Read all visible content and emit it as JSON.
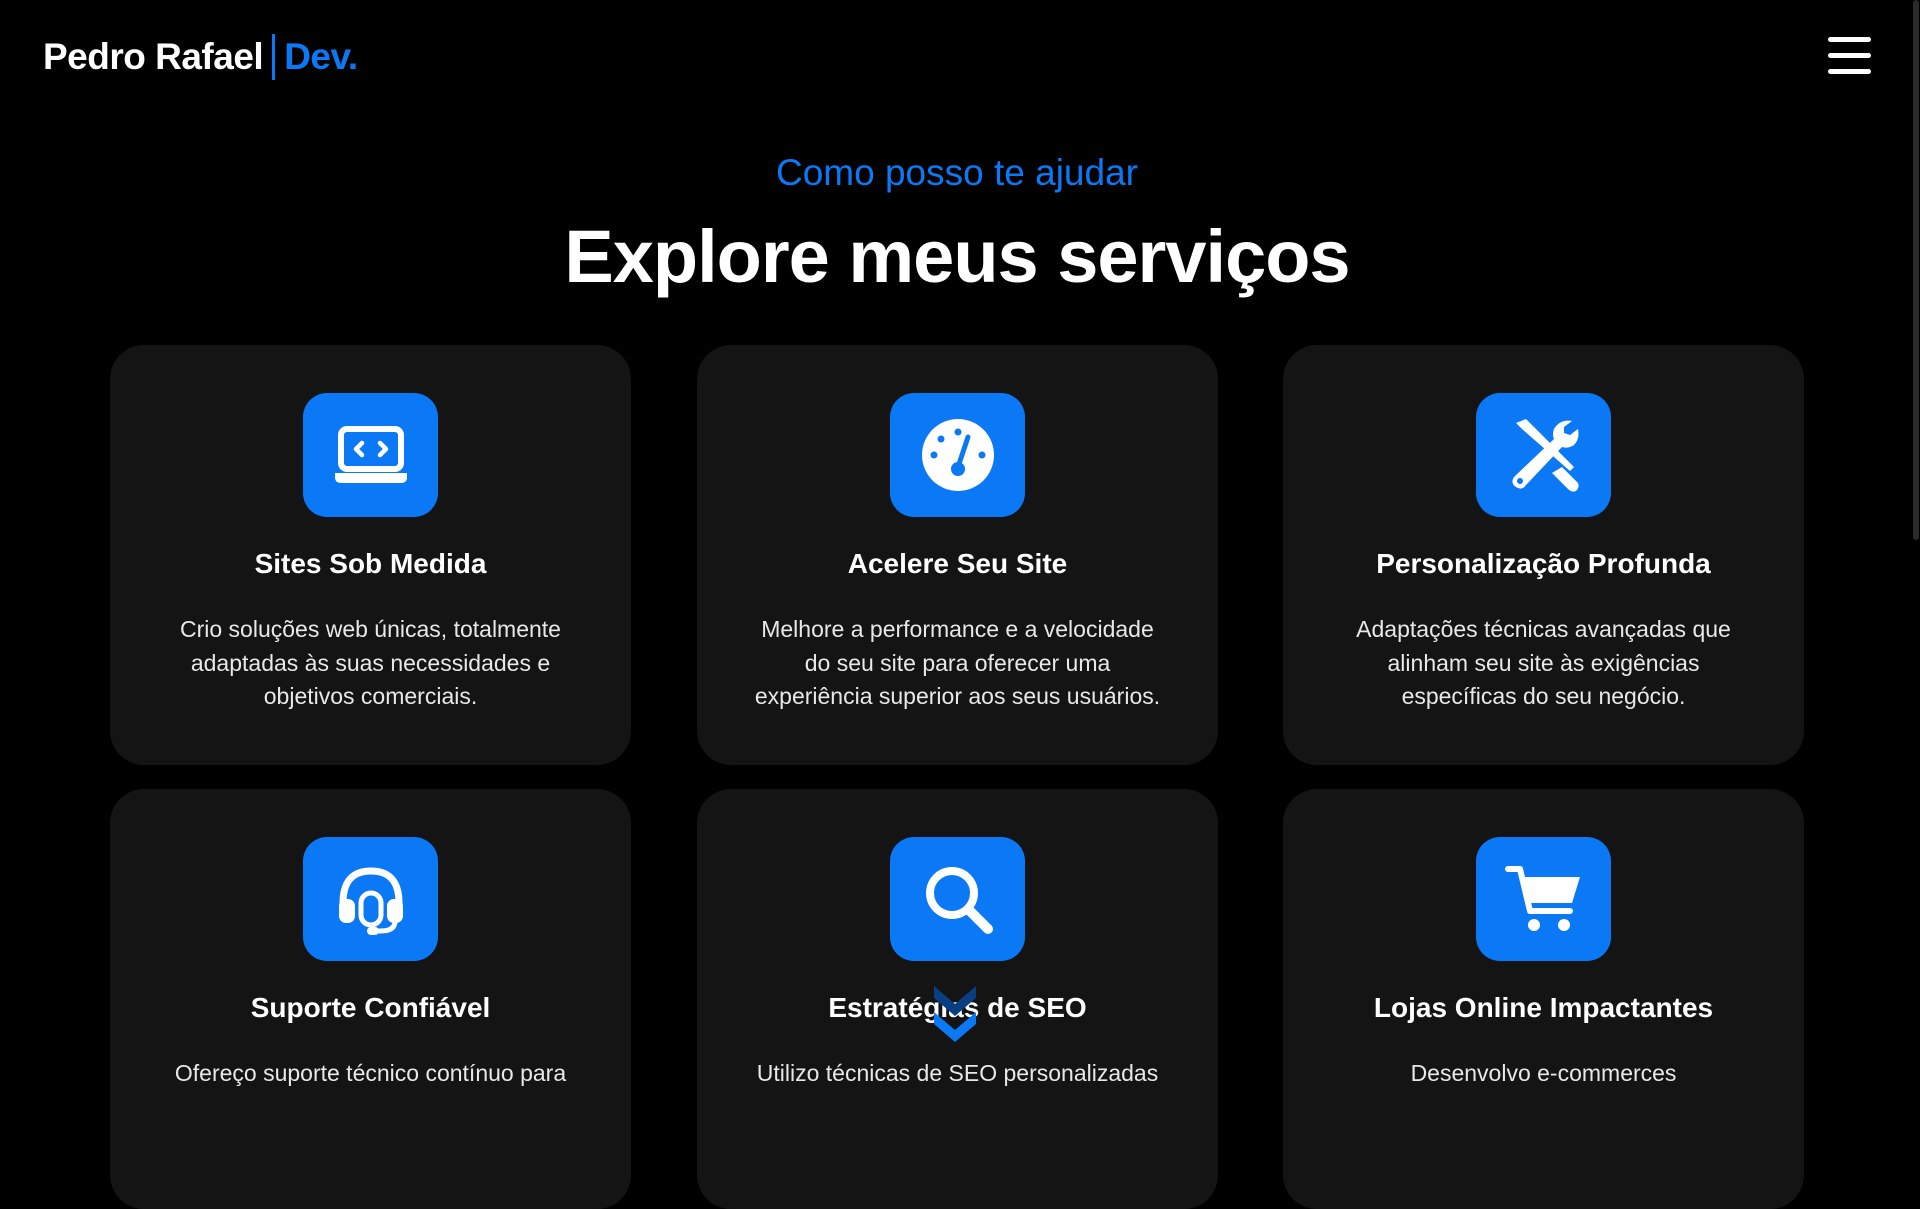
{
  "header": {
    "logo_name": "Pedro Rafael",
    "logo_accent": "Dev.",
    "menu_icon": "hamburger-menu-icon"
  },
  "section": {
    "eyebrow": "Como posso te ajudar",
    "title": "Explore meus serviços"
  },
  "services": [
    {
      "icon": "laptop-code-icon",
      "title": "Sites Sob Medida",
      "description": "Crio soluções web únicas, totalmente adaptadas às suas necessidades e objetivos comerciais."
    },
    {
      "icon": "speedometer-icon",
      "title": "Acelere Seu Site",
      "description": "Melhore a performance e a velocidade do seu site para oferecer uma experiência superior aos seus usuários."
    },
    {
      "icon": "wrench-screwdriver-icon",
      "title": "Personalização Profunda",
      "description": "Adaptações técnicas avançadas que alinham seu site às exigências específicas do seu negócio."
    },
    {
      "icon": "headset-icon",
      "title": "Suporte Confiável",
      "description": "Ofereço suporte técnico contínuo para"
    },
    {
      "icon": "magnifier-icon",
      "title": "Estratégias de SEO",
      "description": "Utilizo técnicas de SEO personalizadas"
    },
    {
      "icon": "shopping-cart-icon",
      "title": "Lojas Online Impactantes",
      "description": "Desenvolvo e-commerces"
    }
  ],
  "scroll_hint_icon": "double-chevron-down-icon",
  "colors": {
    "background": "#000000",
    "card": "#141414",
    "accent": "#0b78f5",
    "text": "#ffffff"
  }
}
